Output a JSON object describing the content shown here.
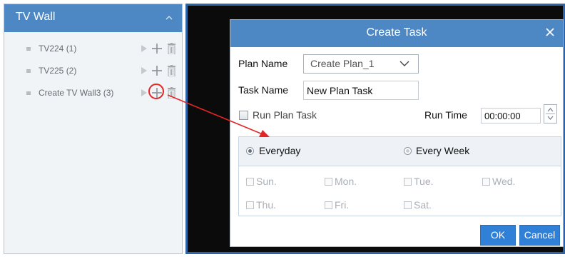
{
  "sidebar": {
    "title": "TV Wall",
    "items": [
      {
        "label": "TV224 (1)"
      },
      {
        "label": "TV225 (2)"
      },
      {
        "label": "Create TV Wall3 (3)"
      }
    ]
  },
  "dialog": {
    "title": "Create Task",
    "plan_name_label": "Plan Name",
    "plan_name_value": "Create Plan_1",
    "task_name_label": "Task Name",
    "task_name_value": "New Plan Task",
    "run_plan_task_label": "Run Plan Task",
    "run_plan_task_checked": false,
    "run_time_label": "Run Time",
    "run_time_value": "00:00:00",
    "frequency": {
      "everyday_label": "Everyday",
      "every_week_label": "Every Week",
      "selected": "Everyday"
    },
    "days": [
      "Sun.",
      "Mon.",
      "Tue.",
      "Wed.",
      "Thu.",
      "Fri.",
      "Sat."
    ],
    "ok_label": "OK",
    "cancel_label": "Cancel"
  },
  "colors": {
    "header_blue": "#4d88c4",
    "button_blue": "#2f80d6",
    "highlight_red": "#e42525",
    "dark_background": "#0b0b0b"
  },
  "icons": [
    "collapse-chevron-up-icon",
    "play-icon",
    "plus-icon",
    "trash-icon",
    "close-icon",
    "chevron-down-icon",
    "spinner-up-icon",
    "spinner-down-icon"
  ]
}
